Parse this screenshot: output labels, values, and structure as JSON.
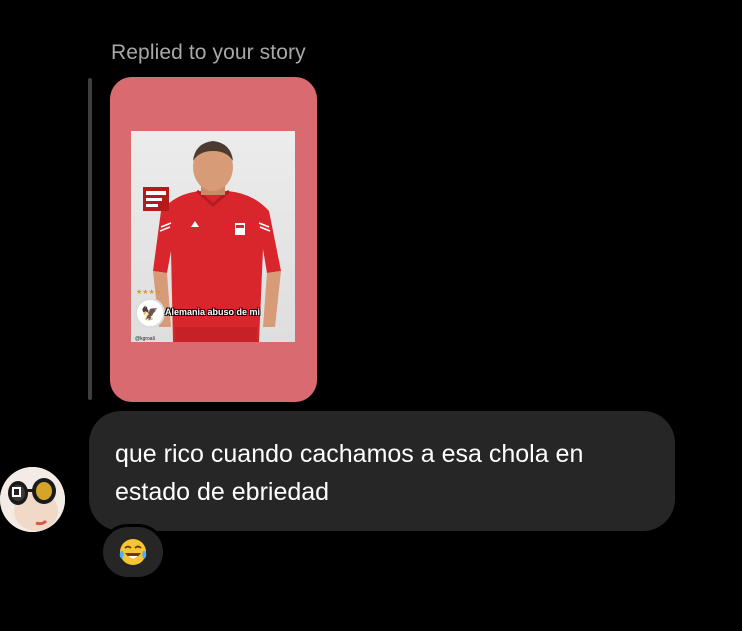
{
  "reply": {
    "label": "Replied to your story"
  },
  "story": {
    "caption": "Alemania abuso de mi",
    "handle": "@kgroali",
    "card_color": "#d96a70"
  },
  "message": {
    "text": "que rico cuando cachamos a esa chola en estado de ebriedad",
    "line1": "que rico cuando cachamos a esa chola en",
    "line2": "estado de ebriedad"
  },
  "reaction": {
    "emoji": "😂",
    "icon": "laughing-tears-emoji-icon"
  },
  "avatar": {
    "icon": "user-avatar"
  },
  "colors": {
    "background": "#000000",
    "bubble": "#262626",
    "secondary_text": "#a8a8a8"
  }
}
